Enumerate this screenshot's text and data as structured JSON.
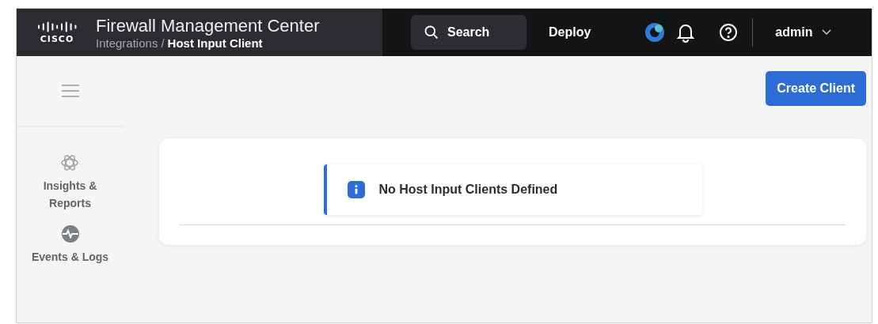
{
  "header": {
    "logo_text": "CISCO",
    "title": "Firewall Management Center",
    "breadcrumb": {
      "parent": "Integrations",
      "separator": "/",
      "current": "Host Input Client"
    },
    "search": {
      "label": "Search"
    },
    "deploy": "Deploy",
    "user": "admin"
  },
  "sidebar": {
    "items": [
      {
        "kind": "insights",
        "label": "Insights &\nReports"
      },
      {
        "kind": "events",
        "label": "Events & Logs"
      }
    ]
  },
  "toolbar": {
    "button": "Create Client"
  },
  "alert": {
    "kind": "info",
    "message": "No Host Input Clients Defined"
  }
}
